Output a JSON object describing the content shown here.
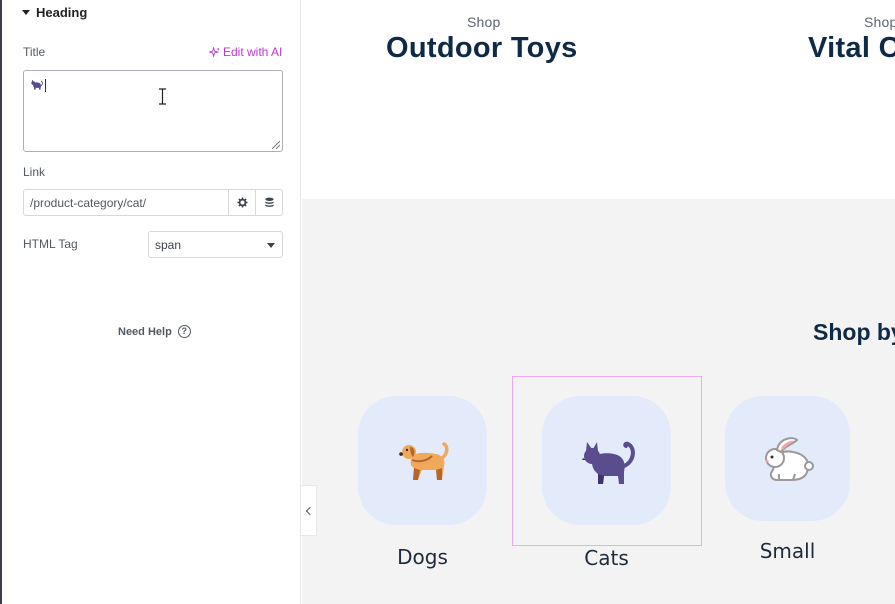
{
  "panel": {
    "section_title": "Heading",
    "title_label": "Title",
    "edit_ai_label": "Edit with AI",
    "link_label": "Link",
    "link_value": "/product-category/cat/",
    "html_tag_label": "HTML Tag",
    "html_tag_value": "span",
    "need_help_label": "Need Help",
    "help_glyph": "?"
  },
  "preview": {
    "card1_shop": "Shop",
    "card1_title": "Outdoor Toys",
    "card2_shop": "Shop",
    "card2_title": "Vital C",
    "section_title": "Shop by",
    "categories": [
      {
        "label": "Dogs",
        "icon": "dog-icon"
      },
      {
        "label": "Cats",
        "icon": "cat-icon"
      },
      {
        "label": "Small",
        "icon": "rabbit-icon"
      }
    ]
  },
  "colors": {
    "accent_ai": "#c036d6",
    "title_navy": "#0e2a47",
    "tile_bg": "#e3ebfb",
    "selection": "#f0a8f0",
    "cat_purple": "#5a4d8f"
  }
}
